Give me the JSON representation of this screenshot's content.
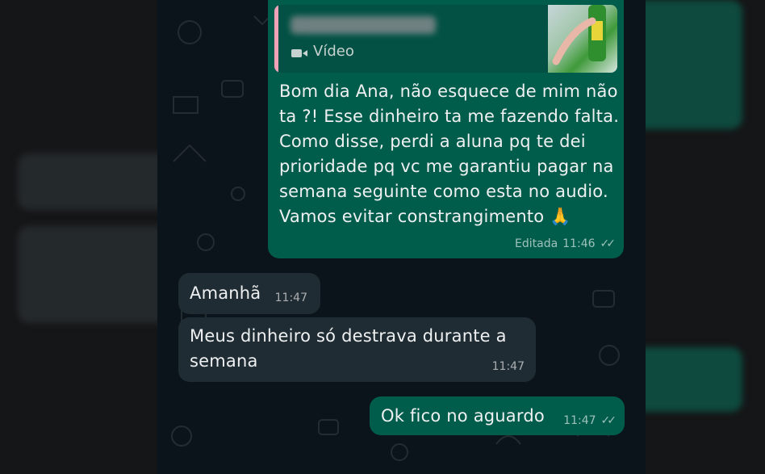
{
  "chat": {
    "messages": [
      {
        "direction": "outgoing",
        "reply_quote": {
          "type_label": "Vídeo",
          "thumbnail_icon": "video-thumbnail"
        },
        "text_lines": [
          "Bom dia Ana, não esquece de mim não",
          "ta ?! Esse dinheiro ta me fazendo falta.",
          "Como disse, perdi a aluna pq te dei",
          "prioridade pq vc me garantiu pagar na",
          "semana seguinte como esta no audio.",
          "Vamos evitar constrangimento 🙏"
        ],
        "edited_label": "Editada",
        "time": "11:46",
        "status_icon": "double-check-icon"
      },
      {
        "direction": "incoming",
        "text_lines": [
          "Amanhã"
        ],
        "time": "11:47"
      },
      {
        "direction": "incoming",
        "text_lines": [
          "Meus dinheiro só destrava durante a",
          "semana"
        ],
        "time": "11:47"
      },
      {
        "direction": "outgoing",
        "text_lines": [
          "Ok fico no aguardo"
        ],
        "time": "11:47",
        "status_icon": "double-check-icon"
      }
    ]
  },
  "colors": {
    "outgoing_bubble": "#005c4b",
    "incoming_bubble": "#202c33",
    "chat_background": "#0b141a"
  }
}
